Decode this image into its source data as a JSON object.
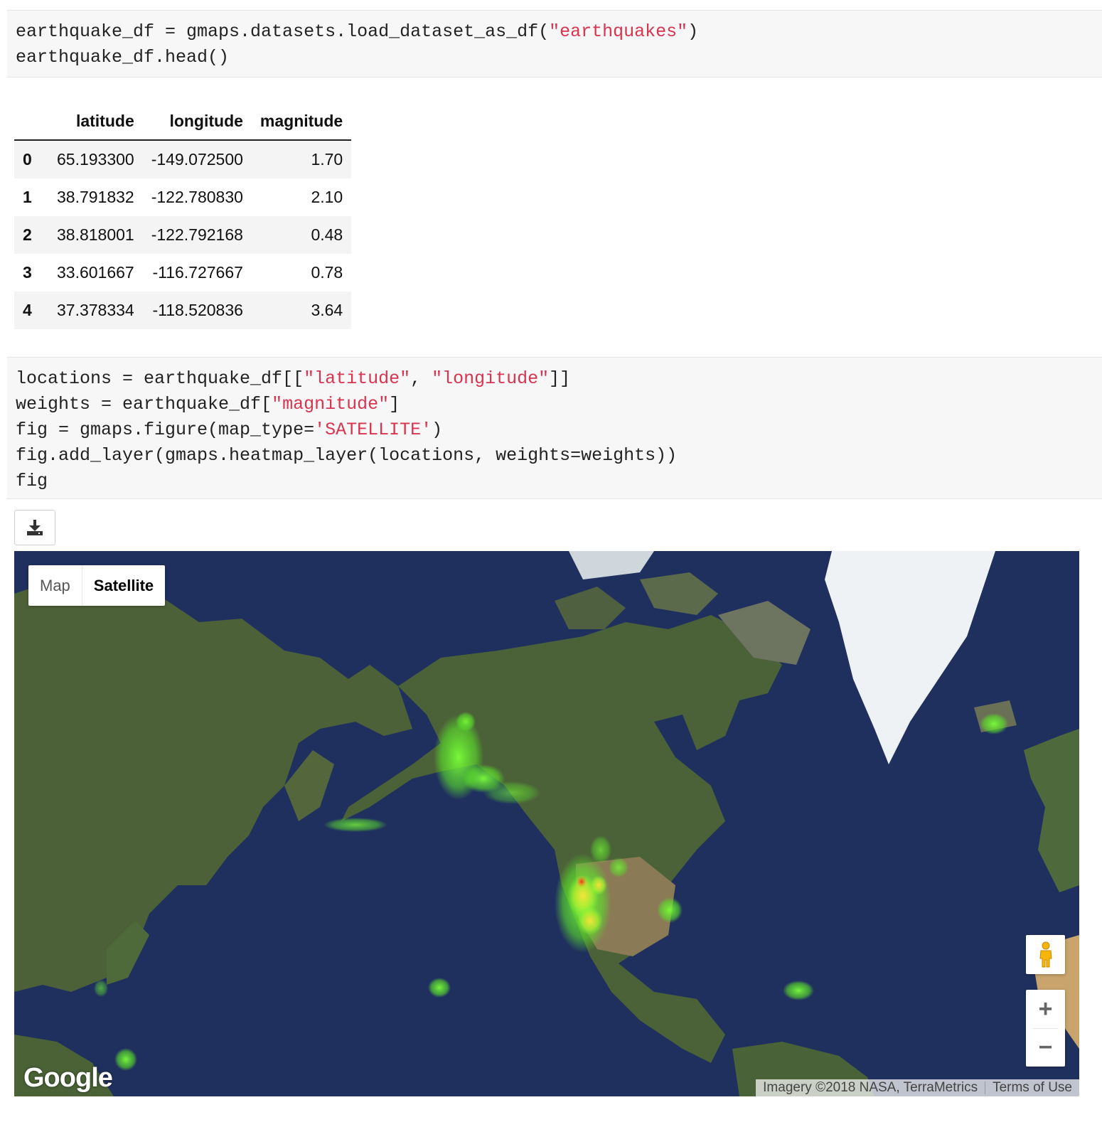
{
  "cells": {
    "cell1": {
      "lines": [
        [
          {
            "t": "earthquake_df = gmaps.datasets.load_dataset_as_df("
          },
          {
            "t": "\"earthquakes\"",
            "s": true
          },
          {
            "t": ")"
          }
        ],
        [
          {
            "t": "earthquake_df.head()"
          }
        ]
      ]
    },
    "cell2": {
      "lines": [
        [
          {
            "t": "locations = earthquake_df[["
          },
          {
            "t": "\"latitude\"",
            "s": true
          },
          {
            "t": ", "
          },
          {
            "t": "\"longitude\"",
            "s": true
          },
          {
            "t": "]]"
          }
        ],
        [
          {
            "t": "weights = earthquake_df["
          },
          {
            "t": "\"magnitude\"",
            "s": true
          },
          {
            "t": "]"
          }
        ],
        [
          {
            "t": "fig = gmaps.figure(map_type="
          },
          {
            "t": "'SATELLITE'",
            "s": true
          },
          {
            "t": ")"
          }
        ],
        [
          {
            "t": "fig.add_layer(gmaps.heatmap_layer(locations, weights=weights))"
          }
        ],
        [
          {
            "t": "fig"
          }
        ]
      ]
    }
  },
  "dataframe": {
    "columns": [
      "latitude",
      "longitude",
      "magnitude"
    ],
    "rows": [
      {
        "index": "0",
        "latitude": "65.193300",
        "longitude": "-149.072500",
        "magnitude": "1.70"
      },
      {
        "index": "1",
        "latitude": "38.791832",
        "longitude": "-122.780830",
        "magnitude": "2.10"
      },
      {
        "index": "2",
        "latitude": "38.818001",
        "longitude": "-122.792168",
        "magnitude": "0.48"
      },
      {
        "index": "3",
        "latitude": "33.601667",
        "longitude": "-116.727667",
        "magnitude": "0.78"
      },
      {
        "index": "4",
        "latitude": "37.378334",
        "longitude": "-118.520836",
        "magnitude": "3.64"
      }
    ]
  },
  "download_button": {
    "icon": "download-icon"
  },
  "map": {
    "type_control": {
      "map_label": "Map",
      "satellite_label": "Satellite",
      "selected": "Satellite"
    },
    "logo": "Google",
    "attribution": "Imagery ©2018 NASA, TerraMetrics",
    "terms": "Terms of Use",
    "zoom_in": "+",
    "zoom_out": "−",
    "pegman_icon": "pegman-icon",
    "colors": {
      "ocean": "#20305e",
      "land": "#4b6238",
      "ice": "#eef2f5",
      "heat_low": "#7cff3a",
      "heat_high": "#ff2a1a"
    }
  }
}
